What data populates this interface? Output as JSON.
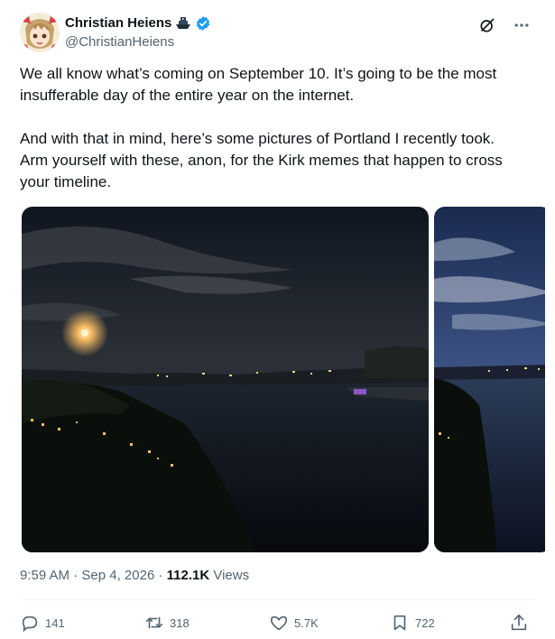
{
  "author": {
    "display_name": "Christian Heiens",
    "handle": "@ChristianHeiens",
    "emoji_label": "ship-emoji",
    "verified": true
  },
  "tweet": {
    "text": "We all know what’s coming on September 10. It’s going to be the most insufferable day of the entire year on the internet.\n\nAnd with that in mind, here’s some pictures of Portland I recently took. Arm yourself with these, anon, for the Kirk memes that happen to cross your timeline."
  },
  "meta": {
    "time": "9:59 AM",
    "separator": "·",
    "date": "Sep 4, 2026",
    "views_count": "112.1K",
    "views_label": "Views"
  },
  "actions": {
    "replies": "141",
    "reposts": "318",
    "likes": "5.7K",
    "bookmarks": "722"
  },
  "colors": {
    "text": "#0f1419",
    "secondary": "#536471",
    "verified": "#1d9bf0",
    "divider": "#eff3f4"
  }
}
